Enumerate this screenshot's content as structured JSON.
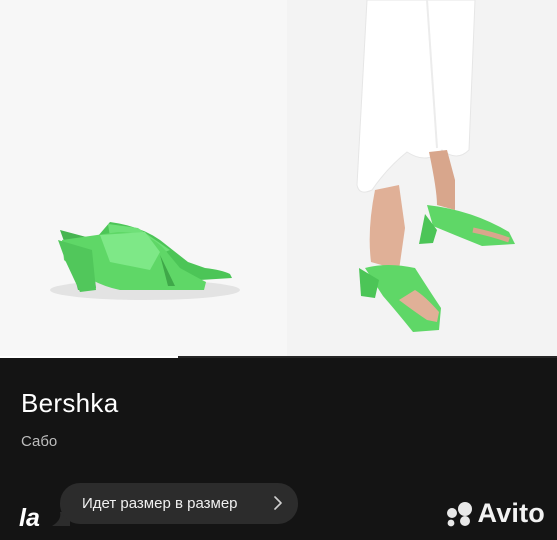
{
  "gallery": {
    "images": [
      {
        "label": "photo-shoes-product"
      },
      {
        "label": "photo-shoes-on-model"
      }
    ],
    "progress": 0.32
  },
  "listing": {
    "brand": "Bershka",
    "category": "Сабо"
  },
  "seller": {
    "logo_text": "la",
    "message": "Идет размер в размер"
  },
  "watermark": {
    "text": "Avito"
  },
  "colors": {
    "background": "#141414",
    "bubble": "#2c2c2c",
    "shoe_green": "#5fd767"
  }
}
